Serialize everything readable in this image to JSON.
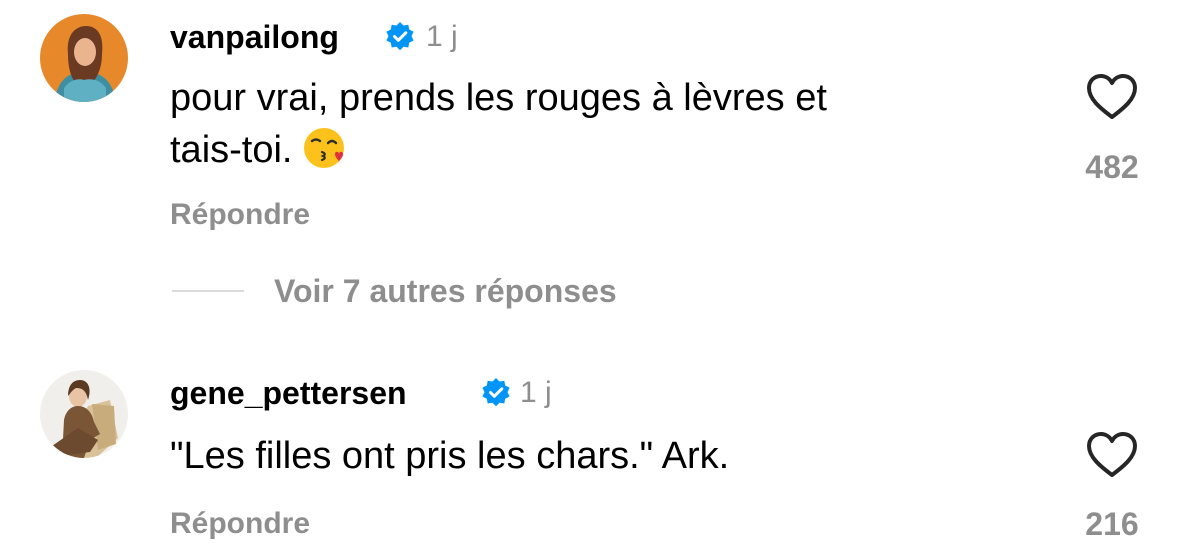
{
  "comments": [
    {
      "username": "vanpailong",
      "verified": true,
      "time": "1 j",
      "text_line1": "pour vrai, prends les rouges à lèvres et",
      "text_line2": "tais-toi.",
      "emoji": "face-blowing-kiss-emoji",
      "reply_label": "Répondre",
      "like_count": "482",
      "avatar_icon": "woman-avatar-orange"
    },
    {
      "username": "gene_pettersen",
      "verified": true,
      "time": "1 j",
      "text": "\"Les filles ont pris les chars.\" Ark.",
      "reply_label": "Répondre",
      "like_count": "216",
      "avatar_icon": "woman-avatar-brown-suit"
    }
  ],
  "view_replies_label": "Voir 7 autres réponses",
  "colors": {
    "text": "#000000",
    "secondary": "#8e8e8e",
    "verified_blue": "#0095f6",
    "divider": "#dbdbdb"
  }
}
